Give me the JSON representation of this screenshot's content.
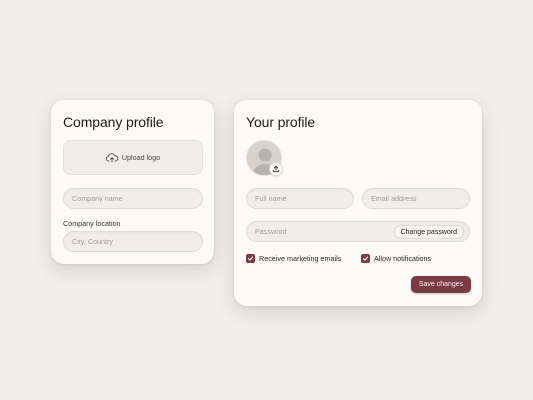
{
  "company_card": {
    "title": "Company profile",
    "upload_label": "Upload logo",
    "company_name_placeholder": "Company name",
    "location_label": "Company location",
    "location_placeholder": "City, Country"
  },
  "profile_card": {
    "title": "Your profile",
    "full_name_placeholder": "Full name",
    "email_placeholder": "Email address",
    "password_placeholder": "Password",
    "change_password_label": "Change password",
    "marketing_label": "Receive marketing emails",
    "marketing_checked": true,
    "notifications_label": "Allow notifications",
    "notifications_checked": true,
    "save_label": "Save changes"
  },
  "colors": {
    "accent": "#7a3b45",
    "background": "#f2eeeb",
    "card": "#fcfbfa"
  },
  "icons": {
    "upload": "cloud-upload-icon",
    "avatar": "user-avatar-icon",
    "avatar_upload": "upload-arrow-icon",
    "check": "check-icon"
  }
}
